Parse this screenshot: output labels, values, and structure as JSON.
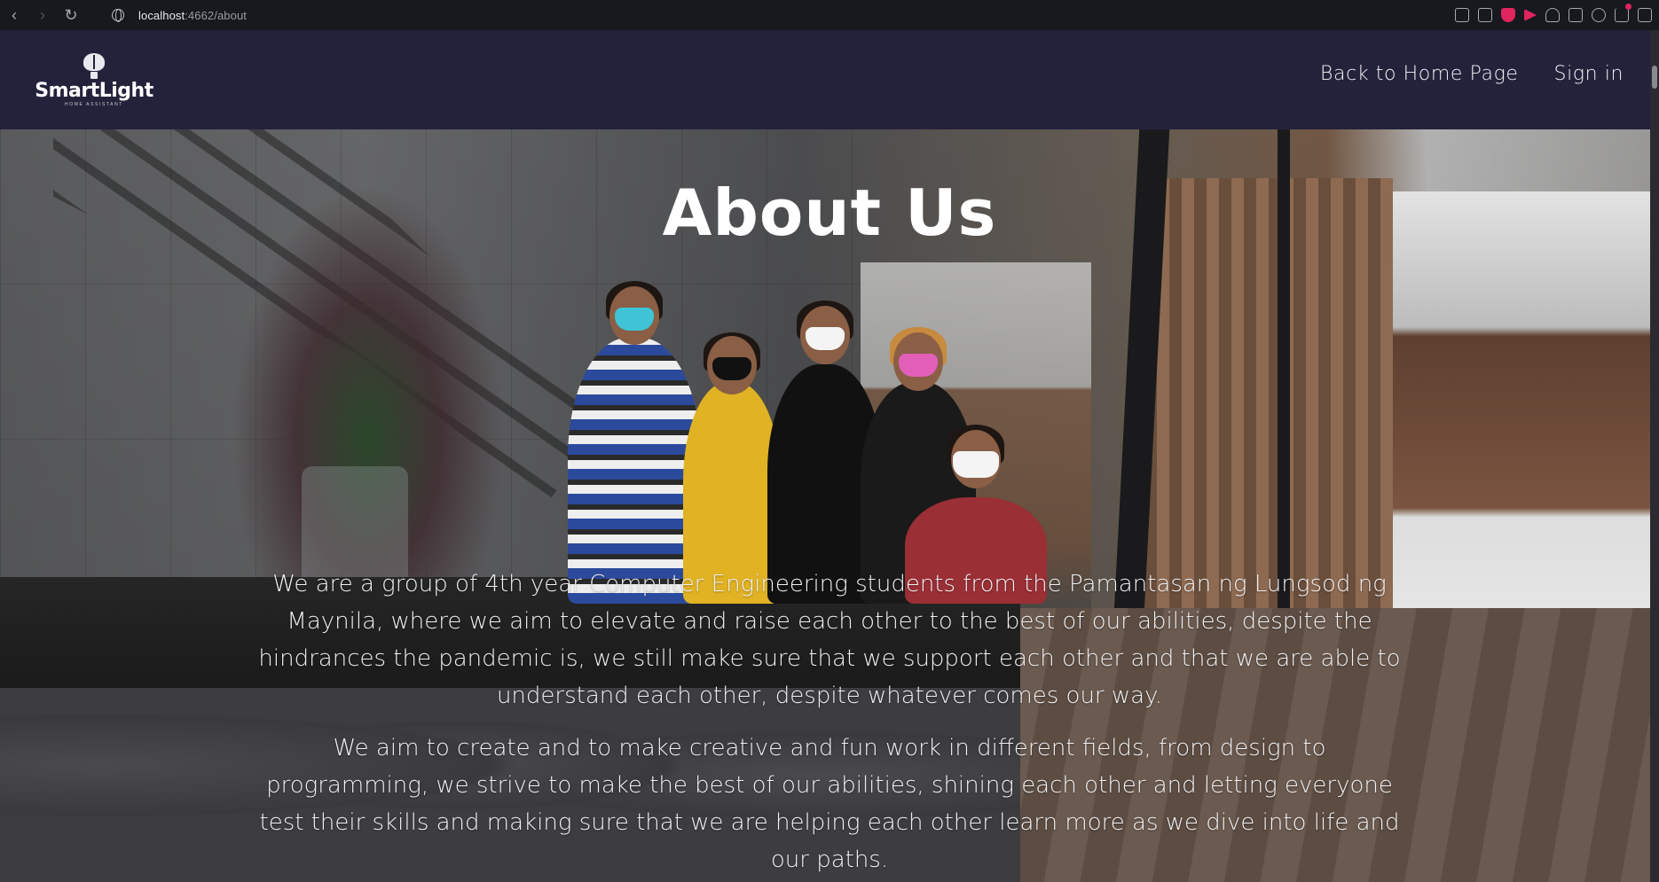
{
  "browser": {
    "url_host": "localhost",
    "url_rest": ":4662/about",
    "back_icon": "back-arrow-icon",
    "forward_icon": "forward-arrow-icon",
    "reload_icon": "reload-icon",
    "back_glyph": "‹",
    "forward_glyph": "›",
    "reload_glyph": "↻"
  },
  "header": {
    "logo_text": "SmartLight",
    "logo_subtext": "HOME ASSISTANT",
    "nav": {
      "home_label": "Back to Home Page",
      "signin_label": "Sign in"
    }
  },
  "hero": {
    "title": "About Us",
    "paragraph_one": "We are a group of 4th year Computer Engineering students from the Pamantasan ng Lungsod ng Maynila, where we aim to elevate and raise each other to the best of our abilities, despite the hindrances the pandemic is, we still make sure that we support each other and that we are able to understand each other, despite whatever comes our way.",
    "paragraph_two": "We aim to create and to make creative and fun work in different fields, from design to programming, we strive to make the best of our abilities, shining each other and letting everyone test their skills and making sure that we are helping each other learn more as we dive into life and our paths."
  },
  "colors": {
    "header_bg": "#24223b",
    "browser_bg": "#18181f",
    "accent": "#e0245e",
    "text": "#ffffff"
  }
}
